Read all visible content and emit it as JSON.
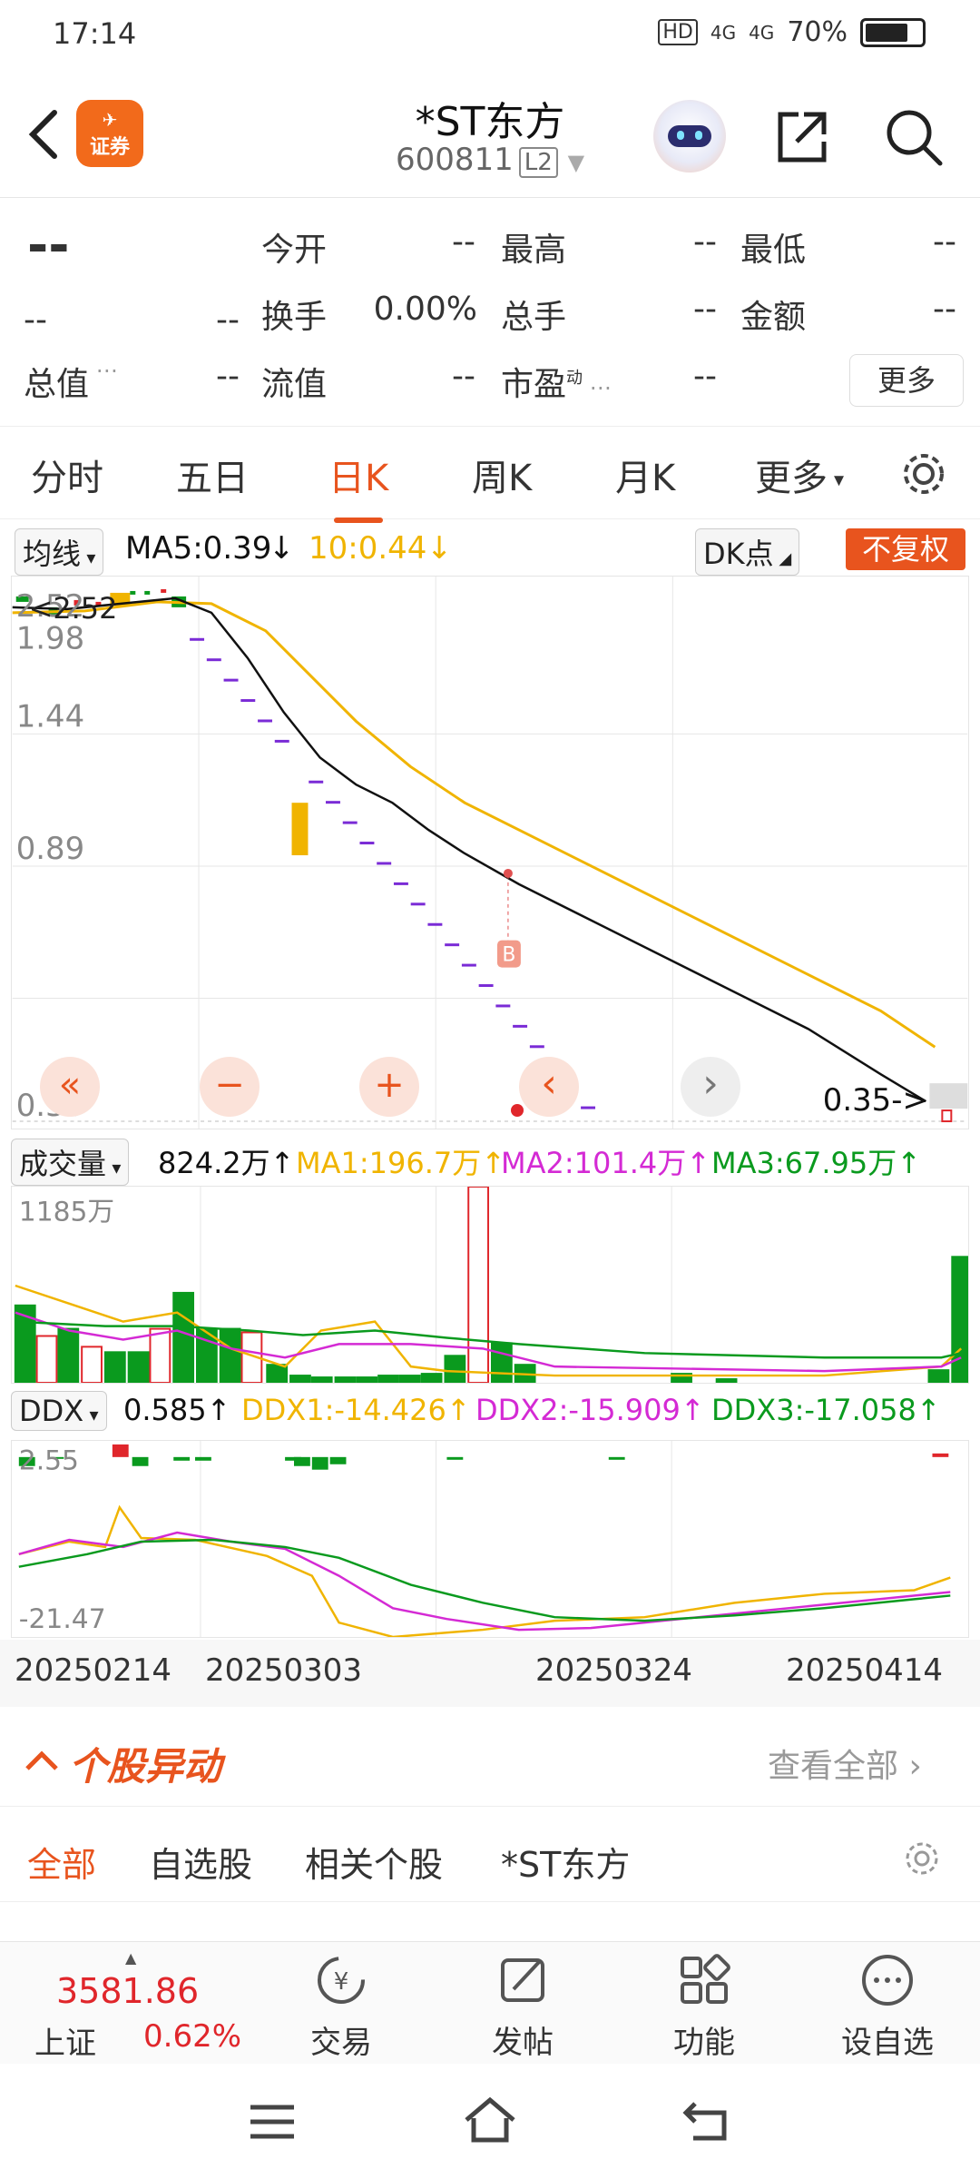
{
  "status_bar": {
    "time": "17:14",
    "hd": "HD",
    "net1": "4G",
    "net2": "4G",
    "battery": "70%"
  },
  "header": {
    "app_badge": "证券",
    "title": "*ST东方",
    "code": "600811",
    "level": "L2"
  },
  "quote": {
    "price": "--",
    "change": "--",
    "change_pct": "--",
    "open_label": "今开",
    "open": "--",
    "high_label": "最高",
    "high": "--",
    "low_label": "最低",
    "low": "--",
    "turnover_label": "换手",
    "turnover": "0.00%",
    "volume_label": "总手",
    "volume": "--",
    "amount_label": "金额",
    "amount": "--",
    "mcap_label": "总值",
    "mcap": "--",
    "float_label": "流值",
    "float": "--",
    "pe_label": "市盈",
    "pe_sup": "动",
    "pe": "--",
    "more": "更多"
  },
  "tabs": [
    {
      "label": "分时"
    },
    {
      "label": "五日"
    },
    {
      "label": "日K"
    },
    {
      "label": "周K"
    },
    {
      "label": "月K"
    },
    {
      "label": "更多"
    }
  ],
  "kline": {
    "selector": "均线",
    "ma5": "MA5:0.39",
    "ma10": "10:0.44",
    "dk": "DK点",
    "rights": "不复权",
    "y_ticks": [
      "2.52",
      "1.98",
      "1.44",
      "0.89",
      "0.35"
    ],
    "high_label": "2.52",
    "last_label": "0.35",
    "b_mark": "B",
    "controls": [
      "«",
      "−",
      "+",
      "‹",
      "›"
    ]
  },
  "volume": {
    "selector": "成交量",
    "value": "824.2万",
    "ma1": "MA1:196.7万",
    "ma2": "MA2:101.4万",
    "ma3": "MA3:67.95万",
    "top": "1185万"
  },
  "ddx": {
    "selector": "DDX",
    "value": "0.585",
    "ddx1": "DDX1:-14.426",
    "ddx2": "DDX2:-15.909",
    "ddx3": "DDX3:-17.058",
    "top": "2.55",
    "bottom": "-21.47"
  },
  "x_labels": [
    "20250214",
    "20250303",
    "20250324",
    "20250414"
  ],
  "abnormal": {
    "title": "个股异动",
    "view_all": "查看全部"
  },
  "sub_tabs": [
    {
      "label": "全部"
    },
    {
      "label": "自选股"
    },
    {
      "label": "相关个股"
    },
    {
      "label": "*ST东方"
    }
  ],
  "index": {
    "value": "3581.86",
    "name": "上证",
    "pct": "0.62%"
  },
  "nav": [
    {
      "label": "交易"
    },
    {
      "label": "发帖"
    },
    {
      "label": "功能"
    },
    {
      "label": "设自选"
    }
  ],
  "colors": {
    "accent": "#e8541e",
    "up": "#e0262b",
    "down": "#0a9a1e",
    "ma10": "#f0b400",
    "ma2": "#d42ad4"
  }
}
